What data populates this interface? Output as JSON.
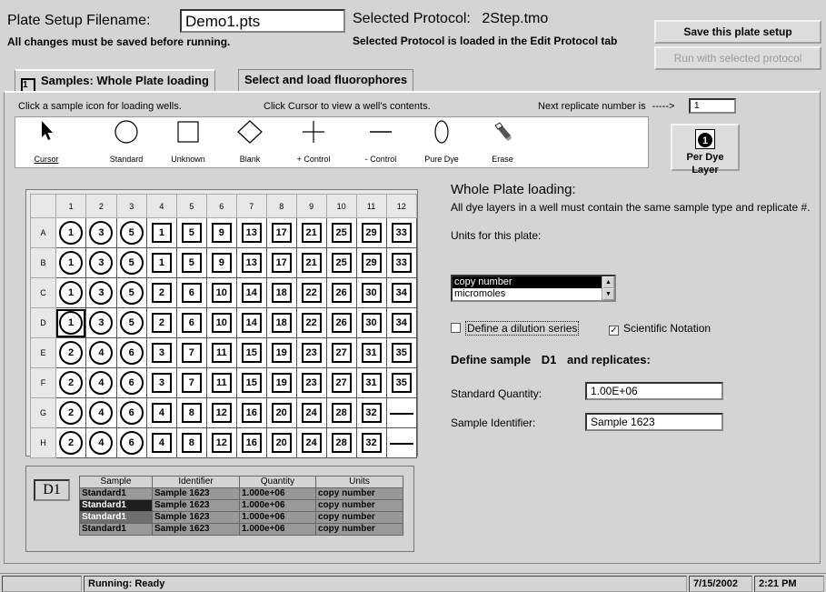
{
  "header": {
    "filename_label": "Plate Setup Filename:",
    "filename_value": "Demo1.pts",
    "protocol_label": "Selected Protocol:",
    "protocol_value": "2Step.tmo",
    "changes_note": "All changes must be saved before running.",
    "protocol_note": "Selected Protocol is loaded in the Edit Protocol tab",
    "save_button": "Save this plate setup",
    "run_button": "Run with selected protocol"
  },
  "tabs": [
    {
      "number": "1",
      "label": "Samples: Whole Plate loading"
    },
    {
      "label": "Select and load fluorophores"
    }
  ],
  "instructions": {
    "click_icon": "Click a sample icon for loading wells.",
    "click_cursor": "Click Cursor to view a well's contents.",
    "next_replicate_label": "Next replicate number is",
    "arrow": "----->",
    "next_replicate_value": "1"
  },
  "tools": [
    {
      "label": "Cursor",
      "icon": "cursor-icon"
    },
    {
      "label": "Standard",
      "icon": "circle-icon"
    },
    {
      "label": "Unknown",
      "icon": "square-icon"
    },
    {
      "label": "Blank",
      "icon": "diamond-icon"
    },
    {
      "label": "+ Control",
      "icon": "plus-icon"
    },
    {
      "label": "- Control",
      "icon": "minus-icon"
    },
    {
      "label": "Pure Dye",
      "icon": "oval-icon"
    },
    {
      "label": "Erase",
      "icon": "eraser-icon"
    }
  ],
  "per_dye_layer": {
    "label": "Per Dye Layer",
    "number": "1"
  },
  "plate": {
    "columns": [
      "1",
      "2",
      "3",
      "4",
      "5",
      "6",
      "7",
      "8",
      "9",
      "10",
      "11",
      "12"
    ],
    "rows": [
      {
        "label": "A",
        "wells": [
          [
            "c",
            "1"
          ],
          [
            "c",
            "3"
          ],
          [
            "c",
            "5"
          ],
          [
            "s",
            "1"
          ],
          [
            "s",
            "5"
          ],
          [
            "s",
            "9"
          ],
          [
            "s",
            "13"
          ],
          [
            "s",
            "17"
          ],
          [
            "s",
            "21"
          ],
          [
            "s",
            "25"
          ],
          [
            "s",
            "29"
          ],
          [
            "s",
            "33"
          ]
        ]
      },
      {
        "label": "B",
        "wells": [
          [
            "c",
            "1"
          ],
          [
            "c",
            "3"
          ],
          [
            "c",
            "5"
          ],
          [
            "s",
            "1"
          ],
          [
            "s",
            "5"
          ],
          [
            "s",
            "9"
          ],
          [
            "s",
            "13"
          ],
          [
            "s",
            "17"
          ],
          [
            "s",
            "21"
          ],
          [
            "s",
            "25"
          ],
          [
            "s",
            "29"
          ],
          [
            "s",
            "33"
          ]
        ]
      },
      {
        "label": "C",
        "wells": [
          [
            "c",
            "1"
          ],
          [
            "c",
            "3"
          ],
          [
            "c",
            "5"
          ],
          [
            "s",
            "2"
          ],
          [
            "s",
            "6"
          ],
          [
            "s",
            "10"
          ],
          [
            "s",
            "14"
          ],
          [
            "s",
            "18"
          ],
          [
            "s",
            "22"
          ],
          [
            "s",
            "26"
          ],
          [
            "s",
            "30"
          ],
          [
            "s",
            "34"
          ]
        ]
      },
      {
        "label": "D",
        "wells": [
          [
            "c",
            "1"
          ],
          [
            "c",
            "3"
          ],
          [
            "c",
            "5"
          ],
          [
            "s",
            "2"
          ],
          [
            "s",
            "6"
          ],
          [
            "s",
            "10"
          ],
          [
            "s",
            "14"
          ],
          [
            "s",
            "18"
          ],
          [
            "s",
            "22"
          ],
          [
            "s",
            "26"
          ],
          [
            "s",
            "30"
          ],
          [
            "s",
            "34"
          ]
        ]
      },
      {
        "label": "E",
        "wells": [
          [
            "c",
            "2"
          ],
          [
            "c",
            "4"
          ],
          [
            "c",
            "6"
          ],
          [
            "s",
            "3"
          ],
          [
            "s",
            "7"
          ],
          [
            "s",
            "11"
          ],
          [
            "s",
            "15"
          ],
          [
            "s",
            "19"
          ],
          [
            "s",
            "23"
          ],
          [
            "s",
            "27"
          ],
          [
            "s",
            "31"
          ],
          [
            "s",
            "35"
          ]
        ]
      },
      {
        "label": "F",
        "wells": [
          [
            "c",
            "2"
          ],
          [
            "c",
            "4"
          ],
          [
            "c",
            "6"
          ],
          [
            "s",
            "3"
          ],
          [
            "s",
            "7"
          ],
          [
            "s",
            "11"
          ],
          [
            "s",
            "15"
          ],
          [
            "s",
            "19"
          ],
          [
            "s",
            "23"
          ],
          [
            "s",
            "27"
          ],
          [
            "s",
            "31"
          ],
          [
            "s",
            "35"
          ]
        ]
      },
      {
        "label": "G",
        "wells": [
          [
            "c",
            "2"
          ],
          [
            "c",
            "4"
          ],
          [
            "c",
            "6"
          ],
          [
            "s",
            "4"
          ],
          [
            "s",
            "8"
          ],
          [
            "s",
            "12"
          ],
          [
            "s",
            "16"
          ],
          [
            "s",
            "20"
          ],
          [
            "s",
            "24"
          ],
          [
            "s",
            "28"
          ],
          [
            "s",
            "32"
          ],
          [
            "d",
            ""
          ]
        ]
      },
      {
        "label": "H",
        "wells": [
          [
            "c",
            "2"
          ],
          [
            "c",
            "4"
          ],
          [
            "c",
            "6"
          ],
          [
            "s",
            "4"
          ],
          [
            "s",
            "8"
          ],
          [
            "s",
            "12"
          ],
          [
            "s",
            "16"
          ],
          [
            "s",
            "20"
          ],
          [
            "s",
            "24"
          ],
          [
            "s",
            "28"
          ],
          [
            "s",
            "32"
          ],
          [
            "d",
            ""
          ]
        ]
      }
    ],
    "selected_well": "D1"
  },
  "right": {
    "title": "Whole Plate loading:",
    "desc": "All dye layers in a well must contain the same sample type and replicate #.",
    "units_label": "Units for this plate:",
    "units_options": [
      "copy number",
      "micromoles"
    ],
    "units_selected": "copy number",
    "dilution_label": "Define a dilution series",
    "dilution_checked": false,
    "sci_label": "Scientific Notation",
    "sci_checked": true,
    "define_label": "Define sample",
    "define_well": "D1",
    "define_suffix": "and replicates:",
    "std_qty_label": "Standard Quantity:",
    "std_qty_value": "1.00E+06",
    "sample_id_label": "Sample Identifier:",
    "sample_id_value": "Sample 1623"
  },
  "summary": {
    "well": "D1",
    "headers": [
      "Sample",
      "Identifier",
      "Quantity",
      "Units"
    ],
    "rows": [
      [
        "Standard1",
        "Sample 1623",
        "1.000e+06",
        "copy number"
      ],
      [
        "Standard1",
        "Sample 1623",
        "1.000e+06",
        "copy number"
      ],
      [
        "Standard1",
        "Sample 1623",
        "1.000e+06",
        "copy number"
      ],
      [
        "Standard1",
        "Sample 1623",
        "1.000e+06",
        "copy number"
      ]
    ],
    "row_swatches": [
      "#9a9a9a",
      "#1e1e1e",
      "#6e6e6e",
      "#9a9a9a"
    ],
    "row_text_colors": [
      "#000000",
      "#ffffff",
      "#ffffff",
      "#000000"
    ]
  },
  "status": {
    "running": "Running: Ready",
    "date": "7/15/2002",
    "time": "2:21 PM"
  }
}
